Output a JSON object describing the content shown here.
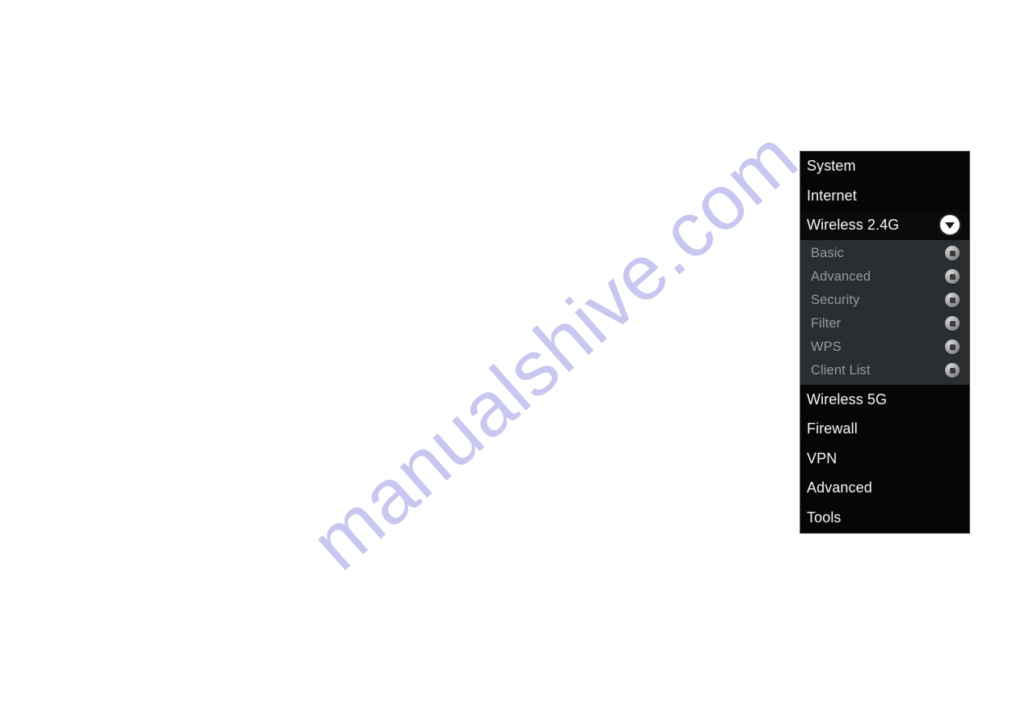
{
  "page": {
    "background_color": "#ffffff"
  },
  "watermark": {
    "text": "manualshive.com",
    "color": "#c7c7ef",
    "rotation_degrees": -41.5
  },
  "nav_panel": {
    "background_color": "#060606",
    "submenu_background_color": "#2b2e31",
    "label_color": "#f2f2f2",
    "submenu_label_color": "#95989d",
    "items": [
      {
        "label": "System",
        "expanded": false
      },
      {
        "label": "Internet",
        "expanded": false
      },
      {
        "label": "Wireless 2.4G",
        "expanded": true,
        "chevron_icon": "chevron-down-icon"
      }
    ],
    "submenu": {
      "parent": "Wireless 2.4G",
      "items": [
        {
          "label": "Basic",
          "icon": "circle-button-icon"
        },
        {
          "label": "Advanced",
          "icon": "circle-button-icon"
        },
        {
          "label": "Security",
          "icon": "circle-button-icon"
        },
        {
          "label": "Filter",
          "icon": "circle-button-icon"
        },
        {
          "label": "WPS",
          "icon": "circle-button-icon"
        },
        {
          "label": "Client List",
          "icon": "circle-button-icon"
        }
      ]
    },
    "items_after": [
      {
        "label": "Wireless 5G",
        "expanded": false
      },
      {
        "label": "Firewall",
        "expanded": false
      },
      {
        "label": "VPN",
        "expanded": false
      },
      {
        "label": "Advanced",
        "expanded": false
      },
      {
        "label": "Tools",
        "expanded": false
      }
    ]
  }
}
